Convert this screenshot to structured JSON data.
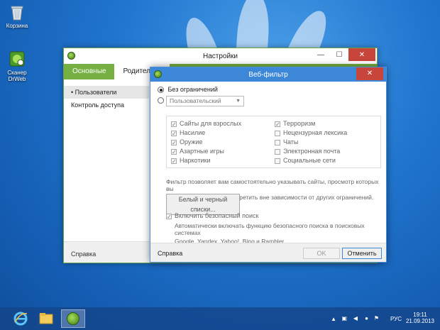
{
  "desktop": {
    "icons": [
      {
        "label": "Корзина",
        "icon": "recycle-bin-icon"
      },
      {
        "label": "Сканер DrWeb",
        "icon": "drweb-scanner-icon"
      }
    ]
  },
  "main_window": {
    "title": "Настройки",
    "tabs": [
      {
        "label": "Основные"
      },
      {
        "label": "Родительск"
      }
    ],
    "sidebar": [
      {
        "label": "• Пользователи"
      },
      {
        "label": "Контроль доступа"
      }
    ],
    "footer_link": "Справка"
  },
  "dialog": {
    "title": "Веб-фильтр",
    "radio_unrestricted": "Без ограничений",
    "select_value": "Пользовательский",
    "categories_left": [
      {
        "label": "Сайты для взрослых",
        "checked": true
      },
      {
        "label": "Насилие",
        "checked": true
      },
      {
        "label": "Оружие",
        "checked": true
      },
      {
        "label": "Азартные игры",
        "checked": true
      },
      {
        "label": "Наркотики",
        "checked": true
      }
    ],
    "categories_right": [
      {
        "label": "Терроризм",
        "checked": true
      },
      {
        "label": "Нецензурная лексика",
        "checked": false
      },
      {
        "label": "Чаты",
        "checked": false
      },
      {
        "label": "Электронная почта",
        "checked": false
      },
      {
        "label": "Социальные сети",
        "checked": false
      }
    ],
    "filter_desc_line1": "Фильтр позволяет вам самостоятельно указывать сайты, просмотр которых вы",
    "filter_desc_line2": "хотите разрешить или запретить вне зависимости от других ограничений.",
    "lists_button": "Белый и черный списки...",
    "safe_search_label": "Включить безопасный поиск",
    "safe_search_desc_line1": "Автоматически включать функцию безопасного поиска в поисковых системах",
    "safe_search_desc_line2": "Google, Yandex, Yahoo!, Bing и Rambler.",
    "footer_link": "Справка",
    "ok_button": "OK",
    "cancel_button": "Отменить"
  },
  "taskbar": {
    "language": "РУС",
    "time": "19:11",
    "date": "21.09.2013"
  }
}
